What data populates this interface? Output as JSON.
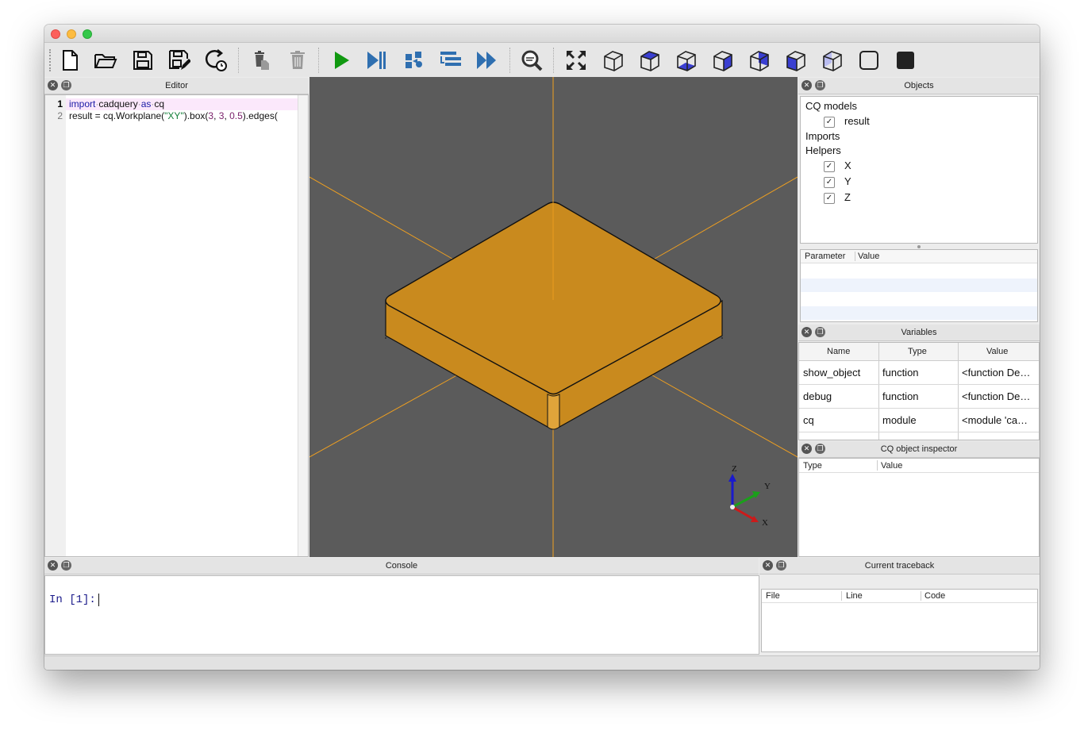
{
  "toolbar": {
    "icons": [
      "new-file",
      "open-file",
      "save-file",
      "save-as",
      "reload",
      "delete-object",
      "delete-all",
      "render",
      "debug",
      "step-in",
      "step-over",
      "continue",
      "inspect",
      "fit-view",
      "iso-view",
      "top-view",
      "bottom-view",
      "front-view",
      "back-view",
      "left-view",
      "right-view",
      "wireframe",
      "shaded"
    ]
  },
  "editor": {
    "title": "Editor",
    "lines": [
      {
        "num": "1",
        "parts": [
          [
            "kw",
            "import"
          ],
          [
            "dot",
            "·"
          ],
          [
            "",
            "cadquery"
          ],
          [
            "dot",
            "·"
          ],
          [
            "kw",
            "as"
          ],
          [
            "dot",
            "·"
          ],
          [
            "",
            "cq"
          ]
        ]
      },
      {
        "num": "2",
        "parts": [
          [
            "",
            "result = cq.Workplane("
          ],
          [
            "str",
            "\"XY\""
          ],
          [
            "",
            ").box("
          ],
          [
            "num",
            "3"
          ],
          [
            "",
            ", "
          ],
          [
            "num",
            "3"
          ],
          [
            "",
            ", "
          ],
          [
            "num",
            "0.5"
          ],
          [
            "",
            ").edges("
          ]
        ]
      }
    ]
  },
  "viewport": {
    "axis_labels": {
      "x": "X",
      "y": "Y",
      "z": "Z"
    }
  },
  "objects": {
    "title": "Objects",
    "tree": [
      {
        "label": "CQ models",
        "checked": null
      },
      {
        "label": "result",
        "checked": true
      },
      {
        "label": "Imports",
        "checked": null
      },
      {
        "label": "Helpers",
        "checked": null
      },
      {
        "label": "X",
        "checked": true
      },
      {
        "label": "Y",
        "checked": true
      },
      {
        "label": "Z",
        "checked": true
      }
    ],
    "param_headers": [
      "Parameter",
      "Value"
    ]
  },
  "variables": {
    "title": "Variables",
    "headers": [
      "Name",
      "Type",
      "Value"
    ],
    "rows": [
      [
        "show_object",
        "function",
        "<function De…"
      ],
      [
        "debug",
        "function",
        "<function De…"
      ],
      [
        "cq",
        "module",
        "<module 'ca…"
      ]
    ]
  },
  "inspector": {
    "title": "CQ object inspector",
    "headers": [
      "Type",
      "Value"
    ]
  },
  "console": {
    "title": "Console",
    "prompt": "In [1]:"
  },
  "traceback": {
    "title": "Current traceback",
    "headers": [
      "File",
      "Line",
      "Code"
    ]
  },
  "colors": {
    "model": "#c98a1e",
    "viewport_bg": "#5b5b5b",
    "axis_line": "#f0a020"
  }
}
